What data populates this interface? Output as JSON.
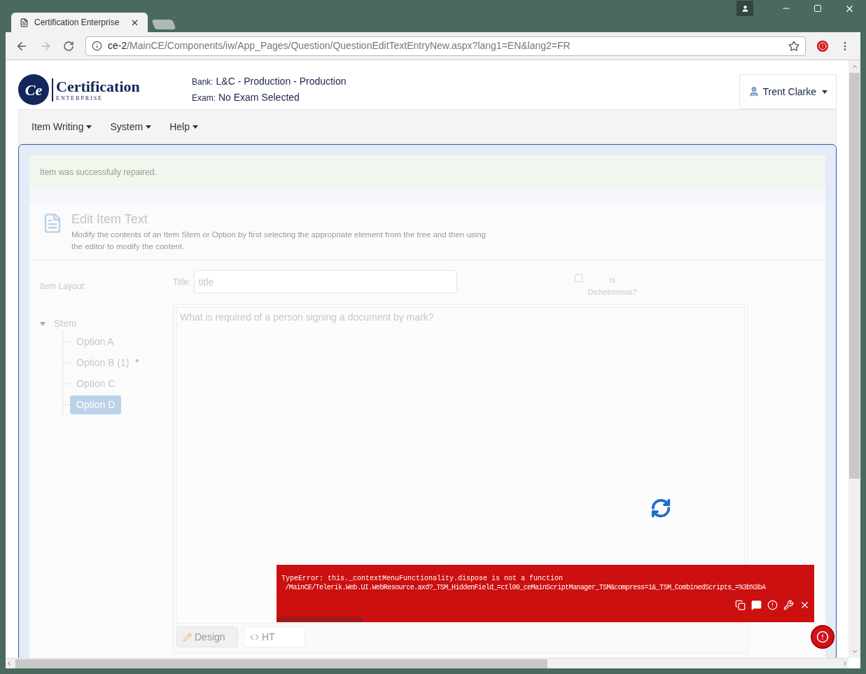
{
  "browser": {
    "tab_title": "Certification Enterprise",
    "url_host": "ce-2",
    "url_path": "/MainCE/Components/iw/App_Pages/Question/QuestionEditTextEntryNew.aspx?lang1=EN&lang2=FR"
  },
  "header": {
    "logo_mark": "Ce",
    "logo_name": "Certification",
    "logo_sub": "E N T E R P R I S E",
    "bank_label": "Bank:",
    "bank_value": "L&C - Production - Production",
    "exam_label": "Exam:",
    "exam_value": "No Exam Selected",
    "user": "Trent Clarke"
  },
  "menu": [
    {
      "label": "Item Writing"
    },
    {
      "label": "System"
    },
    {
      "label": "Help"
    }
  ],
  "alert": "Item was successfully repaired.",
  "section": {
    "title": "Edit Item Text",
    "description": "Modify the contents of an Item Stem or Option by first selecting the appropriate element from the tree and then using the editor to modify the content."
  },
  "layout_label": "Item Layout:",
  "tree": {
    "label": "Stem",
    "expanded": true,
    "selected": false,
    "children": [
      {
        "label": "Option A",
        "selected": false
      },
      {
        "label": "Option B (1)",
        "selected": false,
        "marker": "*"
      },
      {
        "label": "Option C",
        "selected": false
      },
      {
        "label": "Option D",
        "selected": true
      }
    ]
  },
  "title_field": {
    "label": "Title:",
    "placeholder": "title"
  },
  "dichotomous": {
    "label_1": "Is",
    "label_2": "Dichotomous?",
    "checked": false
  },
  "editor": {
    "content": "What is required of a person signing a document by mark?",
    "modes": [
      {
        "label": "Design",
        "selected": true
      },
      {
        "label": "HT",
        "selected": false
      }
    ]
  },
  "error": {
    "level": 0.16,
    "line_1": "TypeError: this._contextMenuFunctionality.dispose is not a function",
    "line_2": " /MainCE/Telerik.Web.UI.WebResource.axd?_TSM_HiddenField_=ctl00_ceMainScriptManager_TSM&compress=1&_TSM_CombinedScripts_=%3b%3bA"
  }
}
